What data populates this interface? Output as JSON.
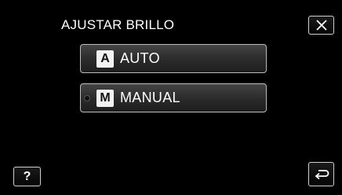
{
  "header": {
    "title": "AJUSTAR BRILLO"
  },
  "options": [
    {
      "badge": "A",
      "label": "AUTO",
      "selected": false
    },
    {
      "badge": "M",
      "label": "MANUAL",
      "selected": true
    }
  ],
  "buttons": {
    "close_icon": "close-icon",
    "help_label": "?",
    "back_icon": "return-icon"
  }
}
